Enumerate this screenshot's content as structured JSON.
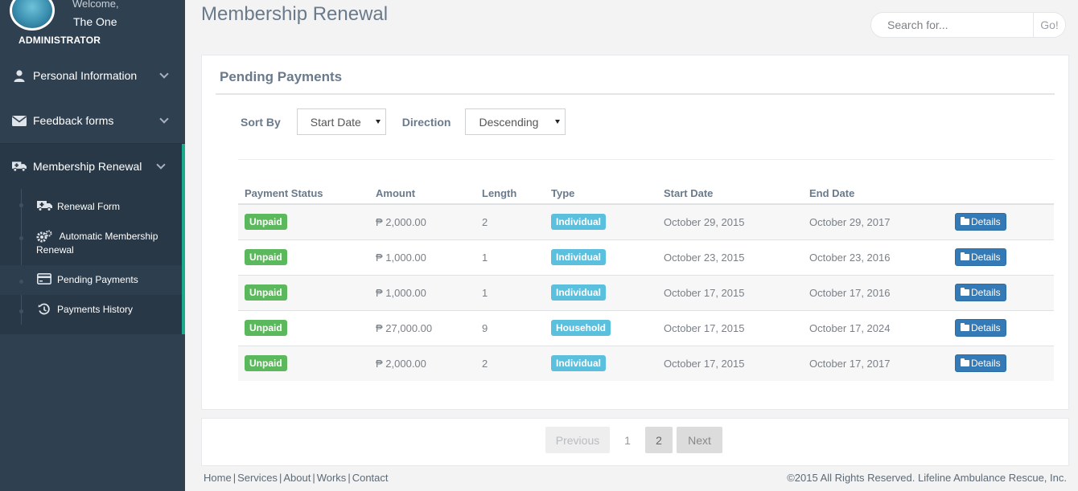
{
  "sidebar": {
    "welcome": "Welcome,",
    "username": "The One",
    "role": "ADMINISTRATOR",
    "items": [
      {
        "label": "Personal Information",
        "icon": "user-icon"
      },
      {
        "label": "Feedback forms",
        "icon": "envelope-icon"
      },
      {
        "label": "Membership Renewal",
        "icon": "ambulance-icon"
      }
    ],
    "subitems": [
      {
        "label": "Renewal Form",
        "icon": "ambulance-icon"
      },
      {
        "label": "Automatic Membership Renewal",
        "icon": "gears-icon"
      },
      {
        "label": "Pending Payments",
        "icon": "credit-card-icon"
      },
      {
        "label": "Payments History",
        "icon": "history-icon"
      }
    ]
  },
  "header": {
    "title": "Membership Renewal",
    "search_placeholder": "Search for...",
    "search_button": "Go!"
  },
  "panel": {
    "title": "Pending Payments",
    "sort_label": "Sort By",
    "sort_value": "Start Date",
    "direction_label": "Direction",
    "direction_value": "Descending"
  },
  "table": {
    "columns": [
      "Payment Status",
      "Amount",
      "Length",
      "Type",
      "Start Date",
      "End Date"
    ],
    "rows": [
      {
        "status": "Unpaid",
        "amount": "₱ 2,000.00",
        "length": "2",
        "type": "Individual",
        "start": "October 29, 2015",
        "end": "October 29, 2017",
        "action": "Details"
      },
      {
        "status": "Unpaid",
        "amount": "₱ 1,000.00",
        "length": "1",
        "type": "Individual",
        "start": "October 23, 2015",
        "end": "October 23, 2016",
        "action": "Details"
      },
      {
        "status": "Unpaid",
        "amount": "₱ 1,000.00",
        "length": "1",
        "type": "Individual",
        "start": "October 17, 2015",
        "end": "October 17, 2016",
        "action": "Details"
      },
      {
        "status": "Unpaid",
        "amount": "₱ 27,000.00",
        "length": "9",
        "type": "Household",
        "start": "October 17, 2015",
        "end": "October 17, 2024",
        "action": "Details"
      },
      {
        "status": "Unpaid",
        "amount": "₱ 2,000.00",
        "length": "2",
        "type": "Individual",
        "start": "October 17, 2015",
        "end": "October 17, 2017",
        "action": "Details"
      }
    ]
  },
  "pagination": {
    "previous": "Previous",
    "pages": [
      "1",
      "2"
    ],
    "current_page": "2",
    "next": "Next"
  },
  "footer": {
    "links": [
      "Home",
      "Services",
      "About",
      "Works",
      "Contact"
    ],
    "copyright": "©2015 All Rights Reserved. Lifeline Ambulance Rescue, Inc."
  },
  "colors": {
    "sidebar_bg": "#2f4050",
    "active_accent": "#19aa8d",
    "status_unpaid": "#5cb85c",
    "type_label": "#5bc0de",
    "details_button": "#337ab7"
  }
}
